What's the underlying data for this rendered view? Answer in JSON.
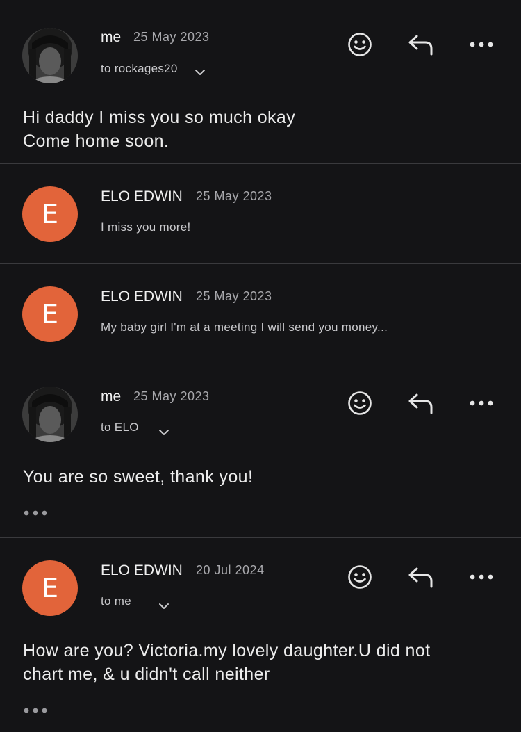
{
  "messages": [
    {
      "sender": "me",
      "date": "25 May 2023",
      "recipient": "to rockages20",
      "body_lines": [
        "Hi daddy I miss you so much okay",
        "Come home soon."
      ]
    },
    {
      "sender": "ELO EDWIN",
      "avatar_letter": "E",
      "date": "25 May 2023",
      "snippet": "I miss you more!"
    },
    {
      "sender": "ELO EDWIN",
      "avatar_letter": "E",
      "date": "25 May 2023",
      "snippet": "My baby girl I'm at a meeting I will send you money..."
    },
    {
      "sender": "me",
      "date": "25 May 2023",
      "recipient": "to ELO",
      "body_lines": [
        "You are so sweet, thank you!"
      ]
    },
    {
      "sender": "ELO EDWIN",
      "avatar_letter": "E",
      "date": "20 Jul 2024",
      "recipient": "to me",
      "body_lines": [
        "How are you? Victoria.my lovely daughter.U did not",
        "chart me, & u didn't call neither"
      ]
    }
  ],
  "colors": {
    "background": "#141416",
    "avatar_accent": "#e2643a",
    "divider": "#3a3a3d"
  },
  "icons": [
    "emoji-icon",
    "reply-icon",
    "more-icon",
    "chevron-down-icon",
    "ellipsis-icon"
  ]
}
